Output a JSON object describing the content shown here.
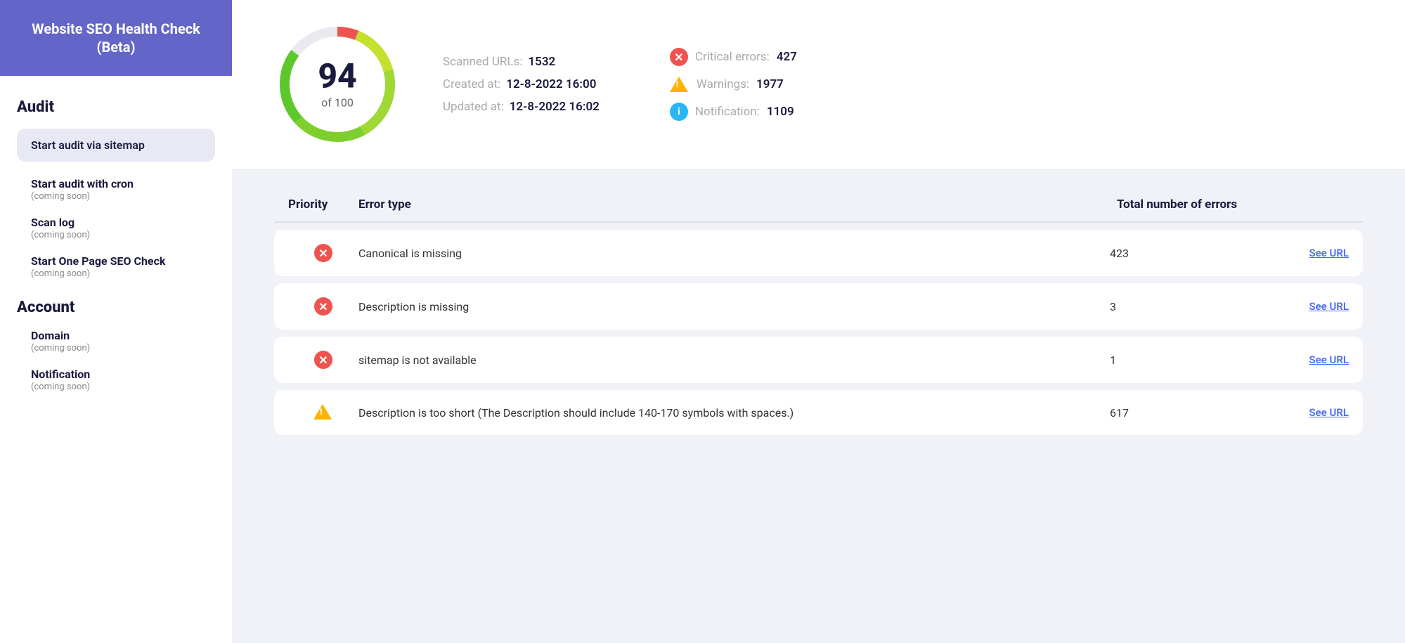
{
  "sidebar": {
    "header": {
      "line1": "Website SEO Health Check",
      "line2": "(Beta)"
    },
    "audit_section": "Audit",
    "active_item": "Start audit via sitemap",
    "items": [
      {
        "name": "Start audit with cron",
        "sub": "(coming soon)"
      },
      {
        "name": "Scan log",
        "sub": "(coming soon)"
      },
      {
        "name": "Start One Page SEO Check",
        "sub": "(coming soon)"
      }
    ],
    "account_section": "Account",
    "account_items": [
      {
        "name": "Domain",
        "sub": "(coming soon)"
      },
      {
        "name": "Notification",
        "sub": "(coming soon)"
      }
    ]
  },
  "score": {
    "value": "94",
    "label": "of 100"
  },
  "stats": {
    "scanned_urls_key": "Scanned URLs:",
    "scanned_urls_val": "1532",
    "created_at_key": "Created at:",
    "created_at_val": "12-8-2022 16:00",
    "updated_at_key": "Updated at:",
    "updated_at_val": "12-8-2022 16:02",
    "critical_key": "Critical errors:",
    "critical_val": "427",
    "warnings_key": "Warnings:",
    "warnings_val": "1977",
    "notification_key": "Notification:",
    "notification_val": "1109"
  },
  "table": {
    "col_priority": "Priority",
    "col_error_type": "Error type",
    "col_total": "Total number of errors",
    "col_action": "",
    "rows": [
      {
        "priority": "critical",
        "error": "Canonical is missing",
        "count": "423",
        "action": "See URL"
      },
      {
        "priority": "critical",
        "error": "Description is missing",
        "count": "3",
        "action": "See URL"
      },
      {
        "priority": "critical",
        "error": "sitemap is not available",
        "count": "1",
        "action": "See URL"
      },
      {
        "priority": "warning",
        "error": "Description is too short (The Description should include 140-170 symbols with spaces.)",
        "count": "617",
        "action": "See URL"
      }
    ]
  },
  "colors": {
    "sidebar_bg": "#6366c8",
    "critical": "#ef5350",
    "warning": "#ffb300",
    "info": "#29b6f6",
    "link": "#4a6cf7"
  }
}
